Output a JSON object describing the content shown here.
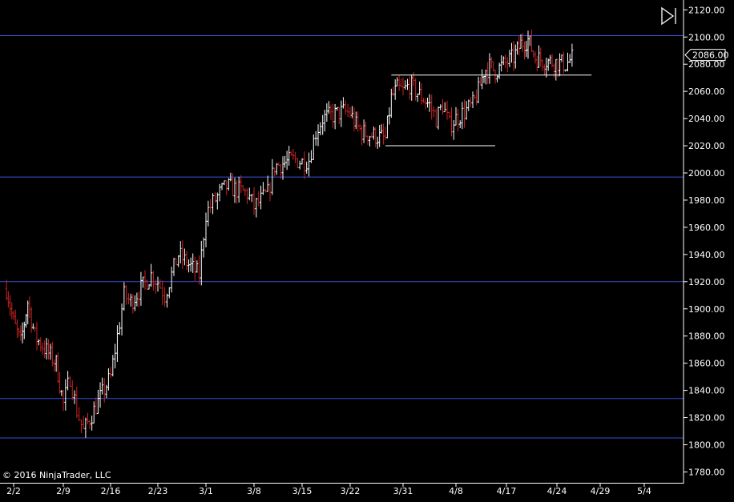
{
  "copyright": "© 2016 NinjaTrader, LLC",
  "toolbar": {
    "scroll_end_icon": "scroll-to-end-icon"
  },
  "colors": {
    "background": "#000000",
    "up_bar": "#ffffff",
    "down_bar": "#cc2222",
    "support_line": "#3a4fd6",
    "trend_line": "#ffffff",
    "axis_text": "#ffffff"
  },
  "chart_data": {
    "type": "ohlc",
    "ylim": [
      1772,
      2126
    ],
    "yticks": [
      1780,
      1800,
      1820,
      1840,
      1860,
      1880,
      1900,
      1920,
      1940,
      1960,
      1980,
      2000,
      2020,
      2040,
      2060,
      2080,
      2100,
      2120
    ],
    "ytick_labels": [
      "1780.00",
      "1800.00",
      "1820.00",
      "1840.00",
      "1860.00",
      "1880.00",
      "1900.00",
      "1920.00",
      "1940.00",
      "1960.00",
      "1980.00",
      "2000.00",
      "2020.00",
      "2040.00",
      "2060.00",
      "2080.00",
      "2100.00",
      "2120.00"
    ],
    "xticks": [
      "2/2",
      "2/9",
      "2/16",
      "2/23",
      "3/1",
      "3/8",
      "3/15",
      "3/22",
      "3/31",
      "4/8",
      "4/17",
      "4/24",
      "4/29",
      "5/4"
    ],
    "current_price": "2086.00",
    "horizontal_levels": [
      2101,
      1997,
      1920,
      1834,
      1805
    ],
    "trend_segments": [
      {
        "from": [
          "3/29",
          2072
        ],
        "to": [
          "4/28",
          2072
        ]
      },
      {
        "from": [
          "3/28",
          2020
        ],
        "to": [
          "4/15",
          2020
        ]
      }
    ],
    "close_path": [
      [
        "2/1",
        1915
      ],
      [
        "2/2",
        1890
      ],
      [
        "2/3",
        1875
      ],
      [
        "2/4",
        1905
      ],
      [
        "2/5",
        1880
      ],
      [
        "2/8",
        1860
      ],
      [
        "2/9",
        1830
      ],
      [
        "2/10",
        1850
      ],
      [
        "2/11",
        1825
      ],
      [
        "2/12",
        1810
      ],
      [
        "2/16",
        1850
      ],
      [
        "2/17",
        1880
      ],
      [
        "2/18",
        1910
      ],
      [
        "2/19",
        1905
      ],
      [
        "2/22",
        1925
      ],
      [
        "2/23",
        1920
      ],
      [
        "2/24",
        1910
      ],
      [
        "2/25",
        1925
      ],
      [
        "2/26",
        1940
      ],
      [
        "2/29",
        1925
      ],
      [
        "3/1",
        1970
      ],
      [
        "3/2",
        1978
      ],
      [
        "3/3",
        1985
      ],
      [
        "3/4",
        1990
      ],
      [
        "3/7",
        1985
      ],
      [
        "3/8",
        1975
      ],
      [
        "3/9",
        1980
      ],
      [
        "3/10",
        1985
      ],
      [
        "3/11",
        2005
      ],
      [
        "3/14",
        2010
      ],
      [
        "3/15",
        2008
      ],
      [
        "3/16",
        2010
      ],
      [
        "3/17",
        2030
      ],
      [
        "3/18",
        2040
      ],
      [
        "3/21",
        2045
      ],
      [
        "3/22",
        2044
      ],
      [
        "3/23",
        2035
      ],
      [
        "3/24",
        2030
      ],
      [
        "3/28",
        2025
      ],
      [
        "3/29",
        2055
      ],
      [
        "3/30",
        2062
      ],
      [
        "3/31",
        2060
      ],
      [
        "4/1",
        2065
      ],
      [
        "4/4",
        2050
      ],
      [
        "4/5",
        2040
      ],
      [
        "4/6",
        2050
      ],
      [
        "4/7",
        2035
      ],
      [
        "4/8",
        2040
      ],
      [
        "4/11",
        2050
      ],
      [
        "4/12",
        2060
      ],
      [
        "4/13",
        2075
      ],
      [
        "4/14",
        2078
      ],
      [
        "4/15",
        2075
      ],
      [
        "4/18",
        2085
      ],
      [
        "4/19",
        2095
      ],
      [
        "4/20",
        2098
      ],
      [
        "4/21",
        2085
      ],
      [
        "4/22",
        2083
      ],
      [
        "4/25",
        2080
      ],
      [
        "4/26",
        2086
      ]
    ]
  }
}
